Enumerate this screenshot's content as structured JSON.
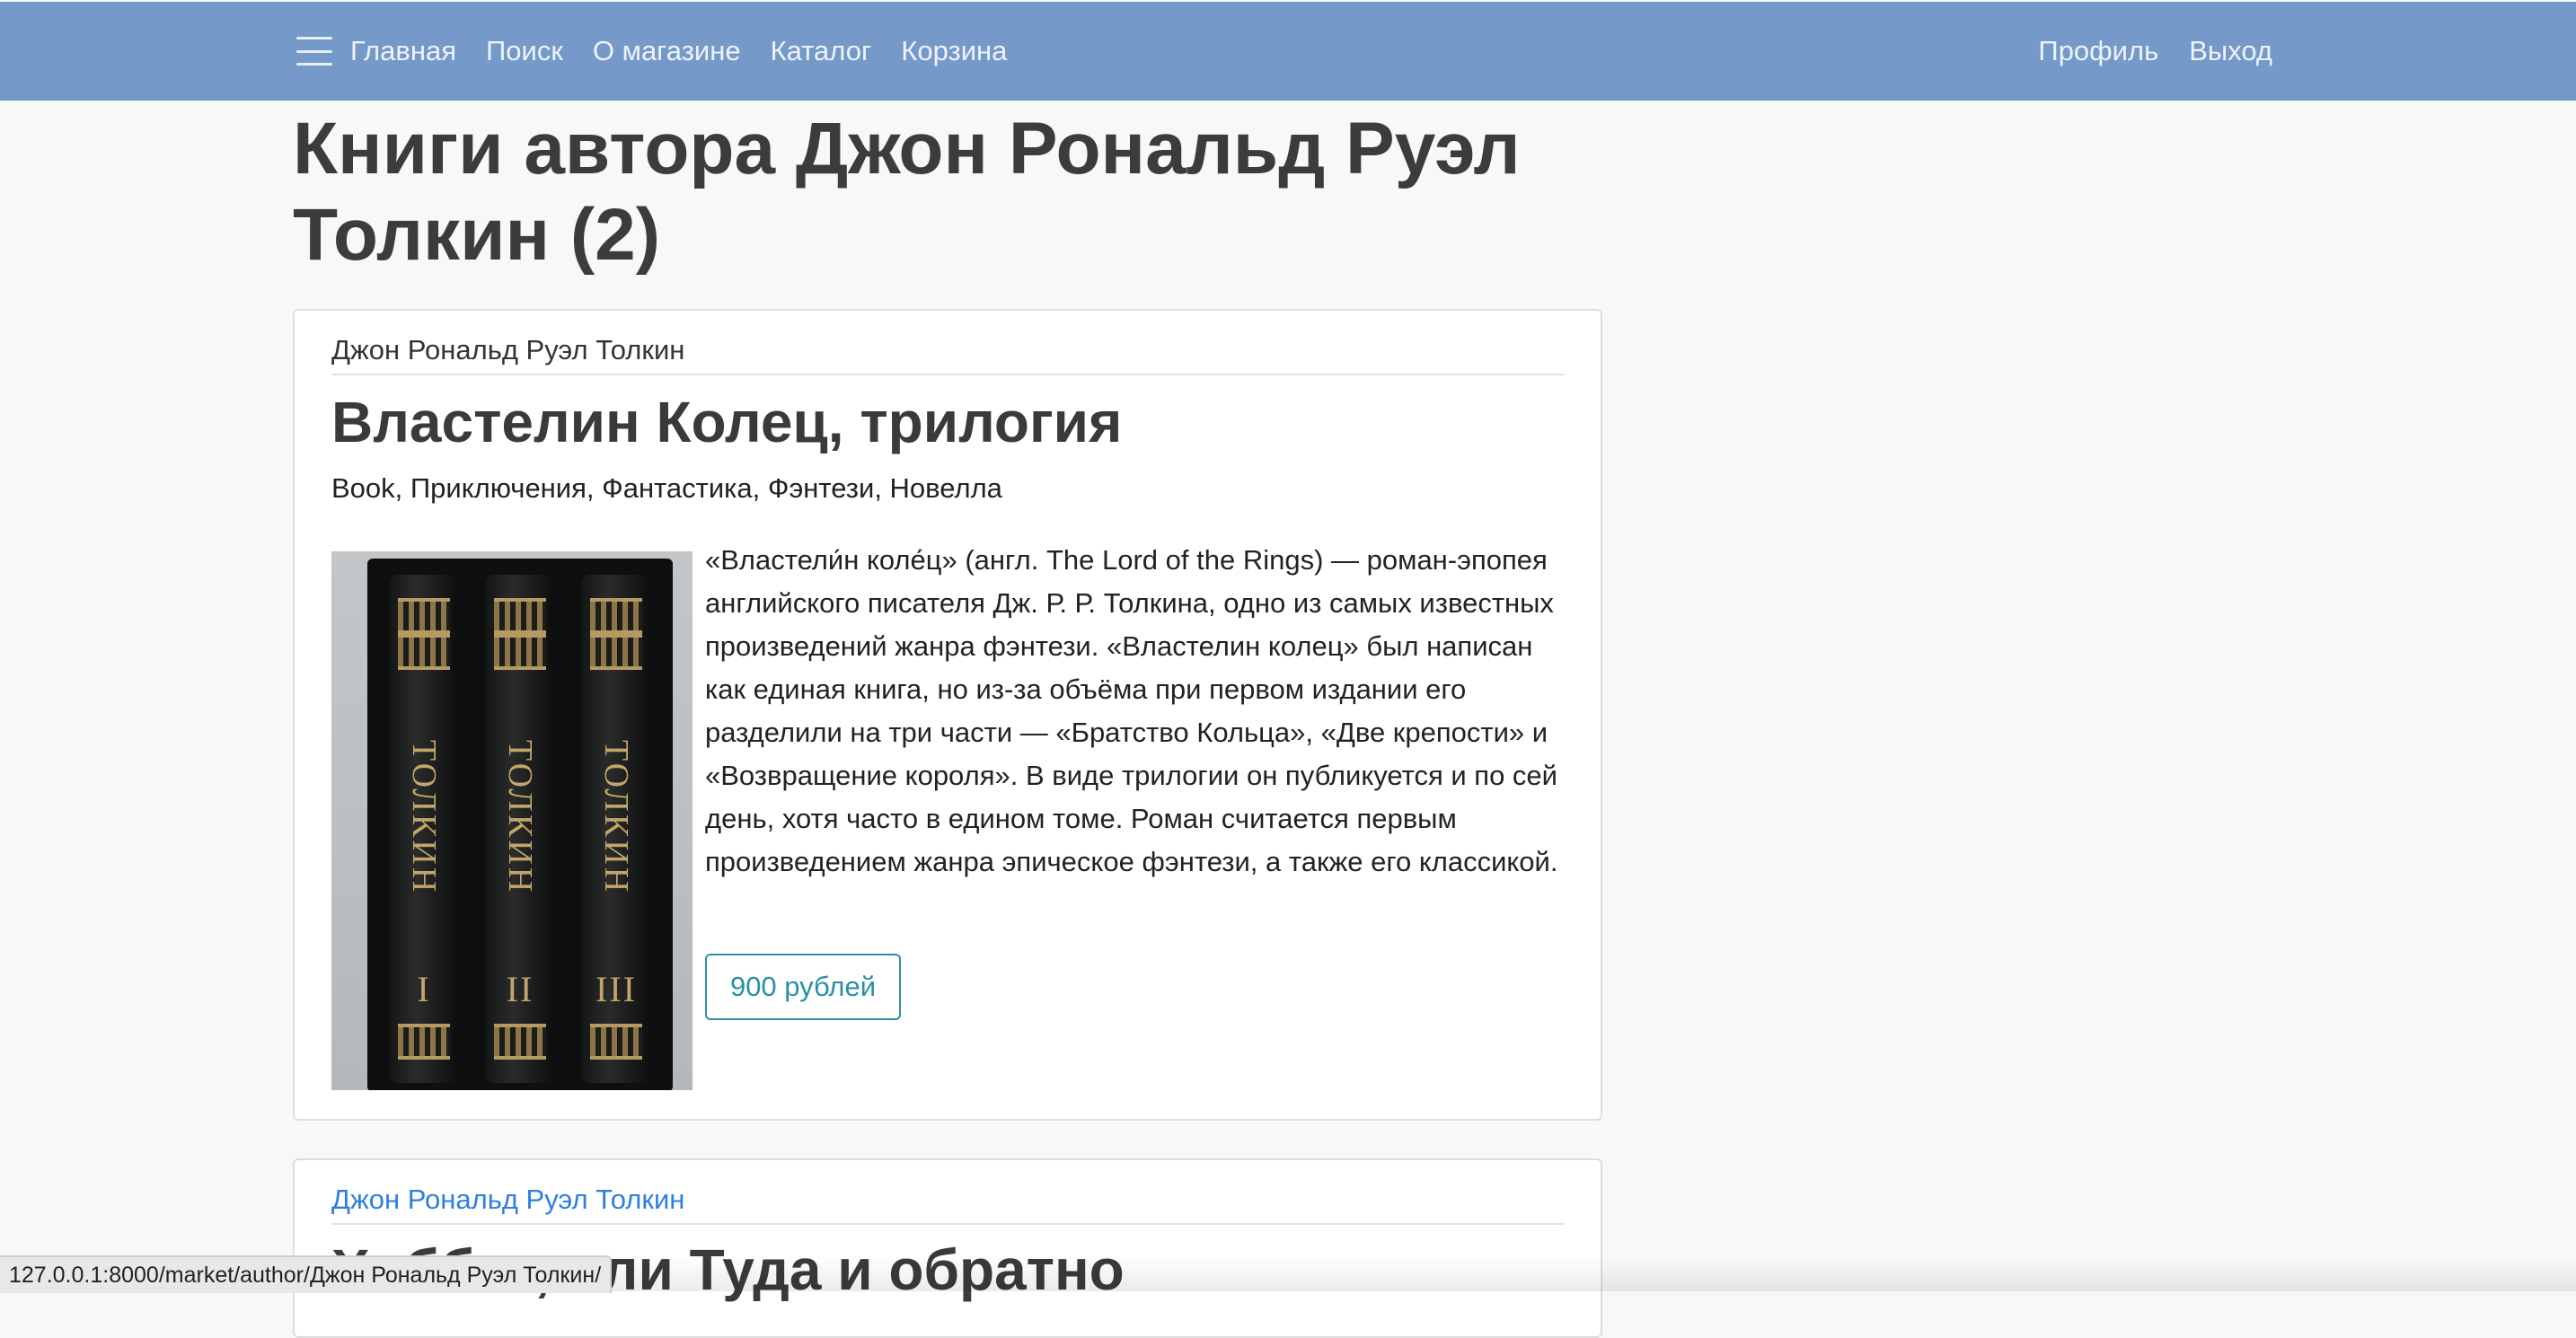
{
  "nav": {
    "left_items": [
      "Главная",
      "Поиск",
      "О магазине",
      "Каталог",
      "Корзина"
    ],
    "right_items": [
      "Профиль",
      "Выход"
    ],
    "menu_icon": "hamburger-icon"
  },
  "page": {
    "title": "Книги автора Джон Рональд Руэл Толкин (2)"
  },
  "books": [
    {
      "author": "Джон Рональд Руэл Толкин",
      "title": "Властелин Колец, трилогия",
      "genres": "Book, Приключения, Фантастика, Фэнтези, Новелла",
      "description": "«Власте­ли́н коле́ц» (англ. The Lord of the Rings) — роман-эпопея английского писателя Дж. Р. Р. Толкина, одно из самых известных произведений жанра фэнтези. «Властелин колец» был написан как единая книга, но из-за объёма при первом издании его разделили на три части — «Братство Кольца», «Две крепости» и «Возвращение короля». В виде трилогии он публикуется и по сей день, хотя часто в едином томе. Роман считается первым произведением жанра эпическое фэнтези, а также его классикой.",
      "price": "900 рублей",
      "cover": {
        "spine_text": "ТОЛКИН",
        "volumes": [
          "I",
          "II",
          "III"
        ]
      }
    },
    {
      "author": "Джон Рональд Руэл Толкин",
      "title": "Хоббит, или Туда и обратно"
    }
  ],
  "status_bar": {
    "url": "127.0.0.1:8000/market/author/Джон Рональд Руэл Толкин/"
  },
  "colors": {
    "navbar": "#7599c8",
    "price_accent": "#2b8fa4",
    "link": "#2f7fe0"
  }
}
